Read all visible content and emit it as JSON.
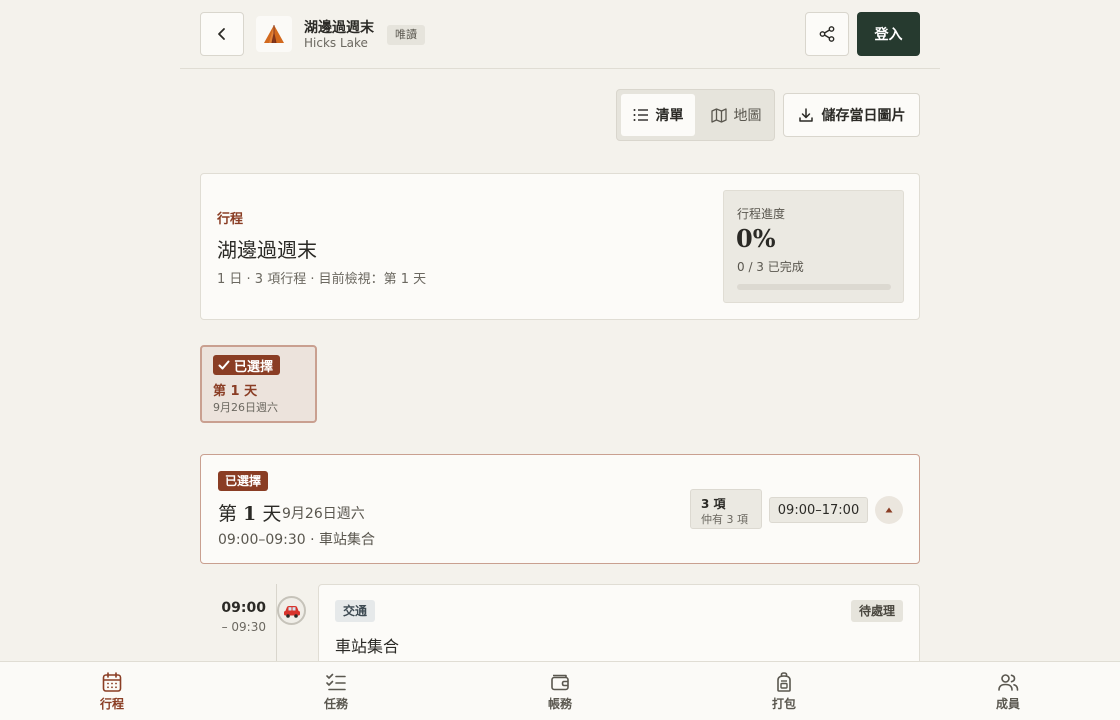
{
  "header": {
    "back_icon": "chevron-left-icon",
    "trip_icon": "tent-icon",
    "trip_name": "湖邊過週末",
    "trip_location": "Hicks Lake",
    "readonly_label": "唯讀",
    "share_icon": "share-icon",
    "login_label": "登入"
  },
  "toolbar": {
    "view_list_label": "清單",
    "view_map_label": "地圖",
    "active_view": "清單",
    "save_day_image_label": "儲存當日圖片"
  },
  "summary": {
    "kicker": "行程",
    "title": "湖邊過週末",
    "meta": "1 日 · 3 項行程 · 目前檢視：第 1 天",
    "progress_label": "行程進度",
    "progress_value": "0%",
    "progress_fraction": 0,
    "progress_count": "0 / 3 已完成"
  },
  "day_chip": {
    "selected_label": "已選擇",
    "day_label": "第 1 天",
    "date_label": "9月26日週六"
  },
  "day_section": {
    "selected_label": "已選擇",
    "title_prefix": "第 ",
    "title_number": "1",
    "title_suffix": " 天",
    "date_label": "9月26日週六",
    "first_item": "09:00–09:30 · 車站集合",
    "count_main": "3 項",
    "count_sub": "仲有 3 項",
    "time_range": "09:00–17:00"
  },
  "events": [
    {
      "start": "09:00",
      "end": "– 09:30",
      "icon": "car-icon",
      "type_label": "交通",
      "status_label": "待處理",
      "title": "車站集合"
    }
  ],
  "bottom_nav": [
    {
      "label": "行程",
      "icon": "calendar-icon",
      "active": true
    },
    {
      "label": "任務",
      "icon": "checklist-icon",
      "active": false
    },
    {
      "label": "帳務",
      "icon": "wallet-icon",
      "active": false
    },
    {
      "label": "打包",
      "icon": "backpack-icon",
      "active": false
    },
    {
      "label": "成員",
      "icon": "users-icon",
      "active": false
    }
  ],
  "colors": {
    "accent": "#8a3d24",
    "login_bg": "#263a2f",
    "background": "#f4f2ec"
  }
}
